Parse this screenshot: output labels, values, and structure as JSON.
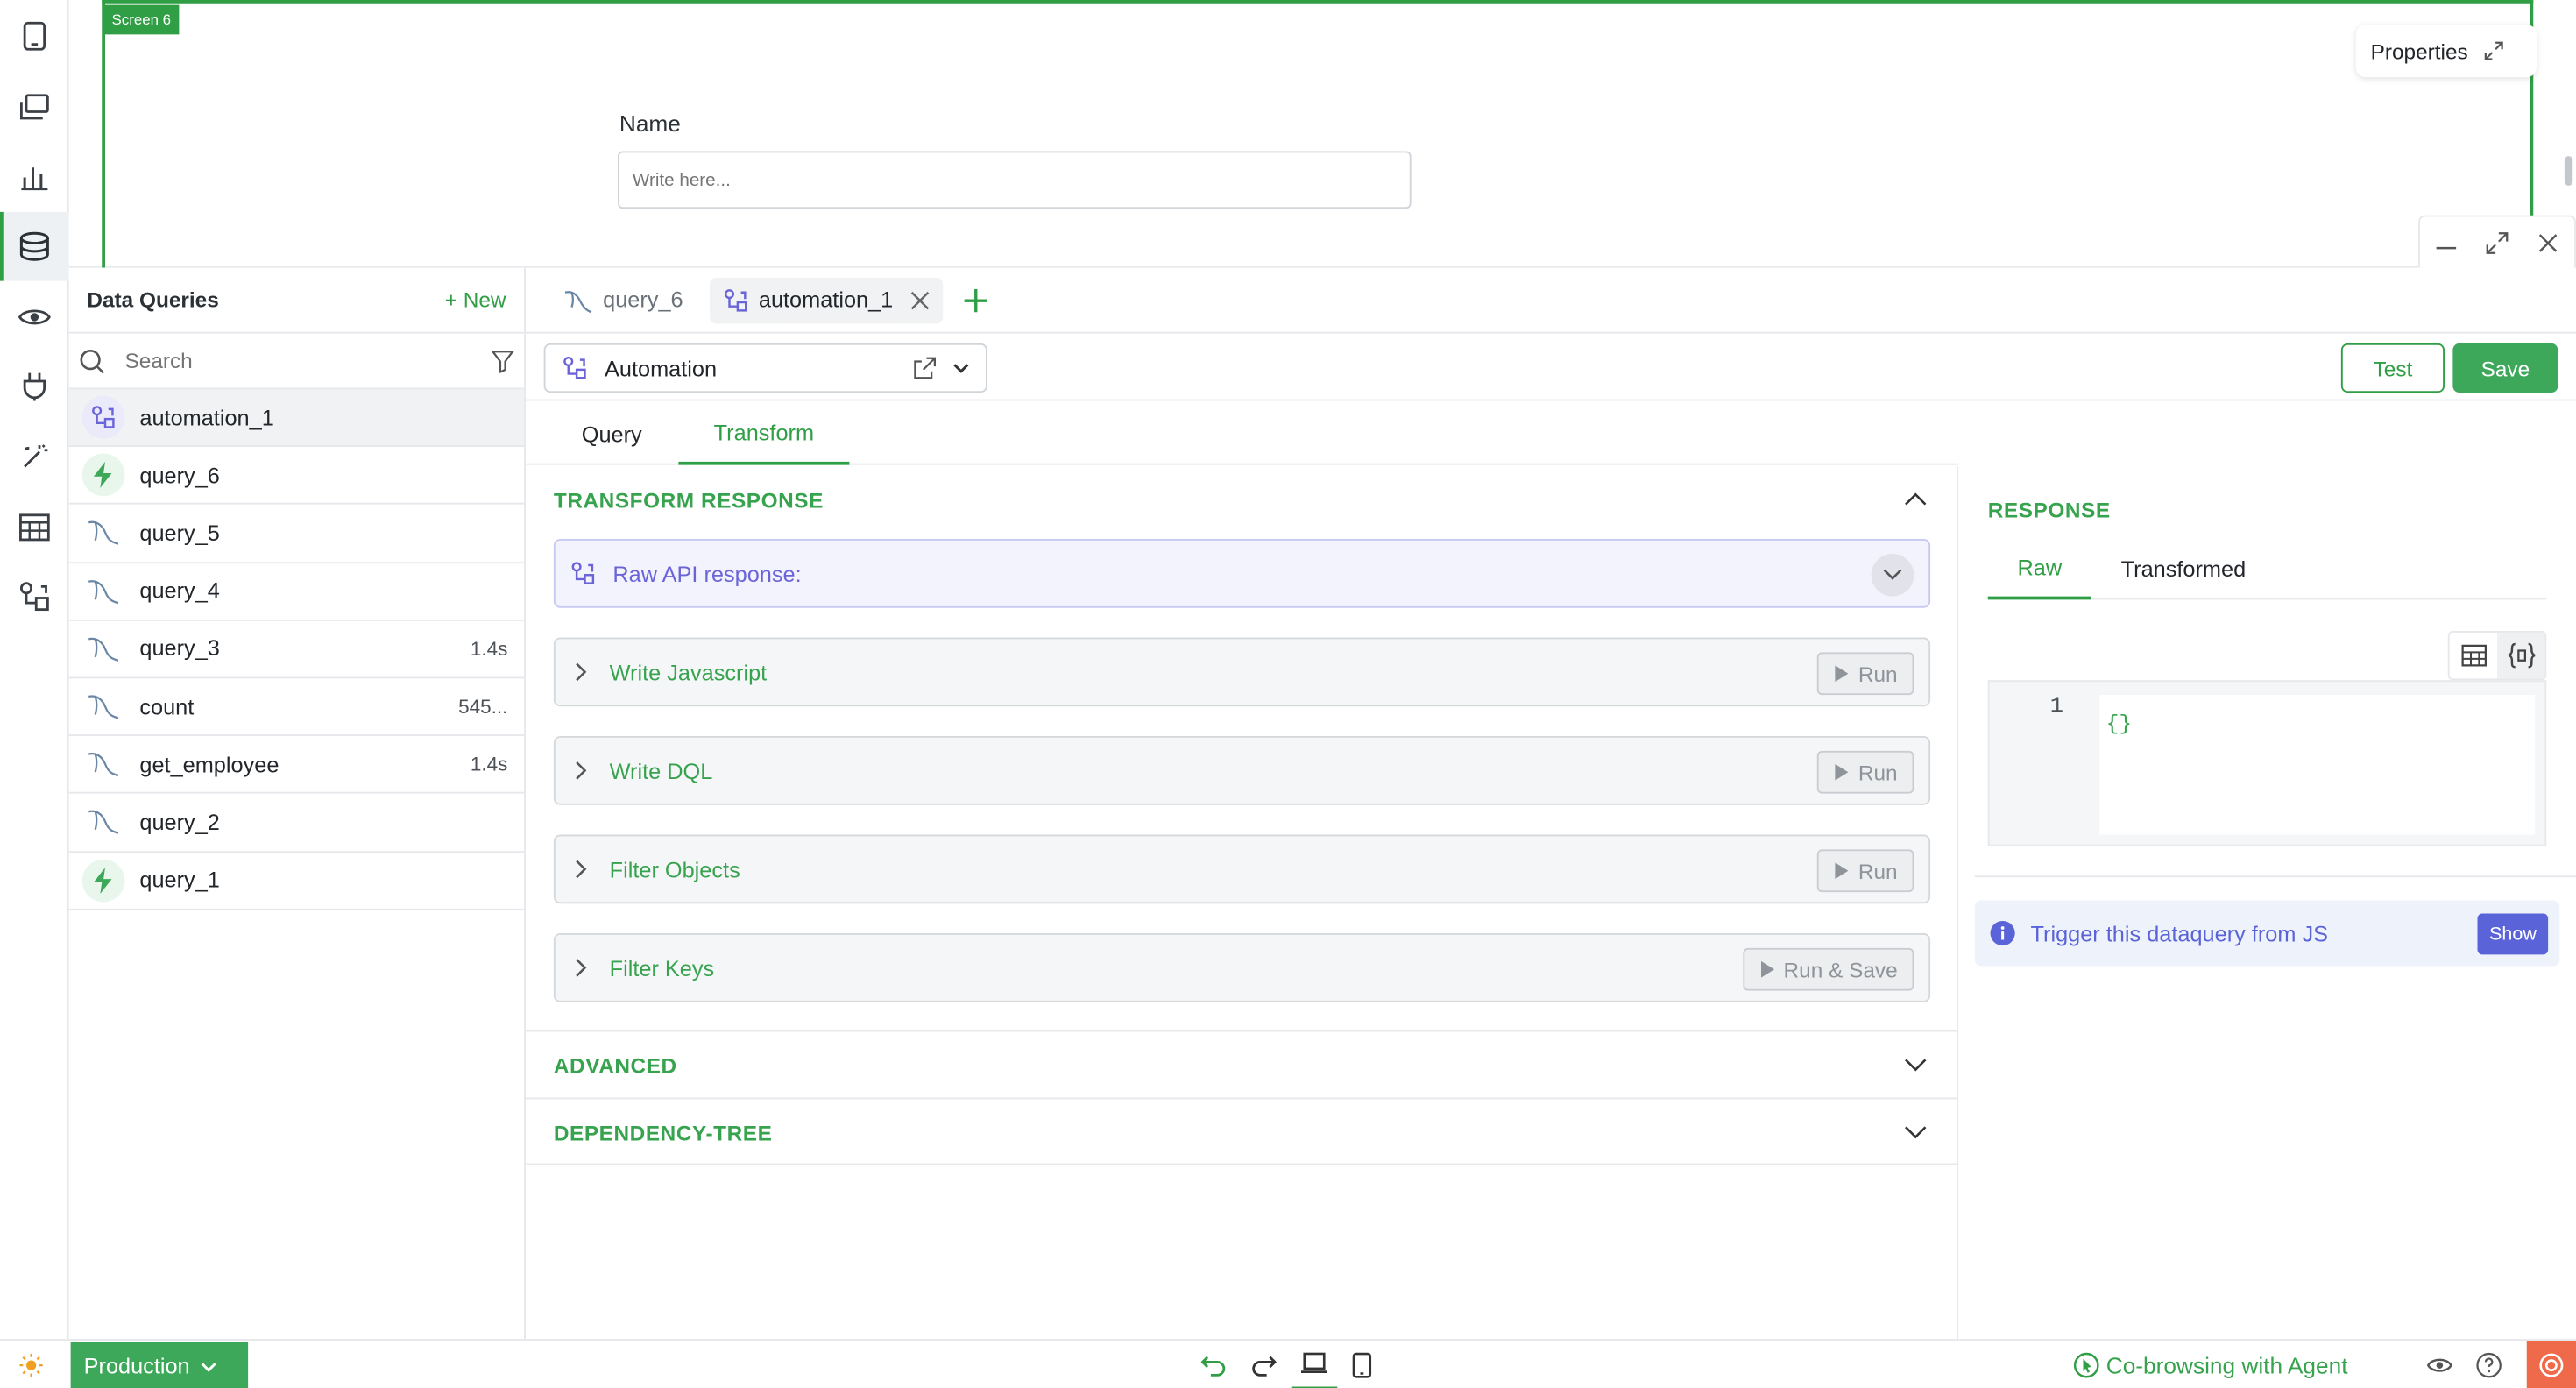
{
  "canvas": {
    "screen_tag": "Screen 6",
    "field_label": "Name",
    "field_placeholder": "Write here...",
    "properties_label": "Properties"
  },
  "queries_panel": {
    "title": "Data Queries",
    "new_label": "+ New",
    "search_placeholder": "Search",
    "items": [
      {
        "name": "automation_1",
        "meta": "",
        "icon": "automation-icon"
      },
      {
        "name": "query_6",
        "meta": "",
        "icon": "bolt-icon"
      },
      {
        "name": "query_5",
        "meta": "",
        "icon": "mysql-icon"
      },
      {
        "name": "query_4",
        "meta": "",
        "icon": "mysql-icon"
      },
      {
        "name": "query_3",
        "meta": "1.4s",
        "icon": "mysql-icon"
      },
      {
        "name": "count",
        "meta": "545...",
        "icon": "mysql-icon"
      },
      {
        "name": "get_employee",
        "meta": "1.4s",
        "icon": "mysql-icon"
      },
      {
        "name": "query_2",
        "meta": "",
        "icon": "mysql-icon"
      },
      {
        "name": "query_1",
        "meta": "",
        "icon": "bolt-icon"
      }
    ]
  },
  "tabs": [
    {
      "label": "query_6",
      "icon": "mysql-icon"
    },
    {
      "label": "automation_1",
      "icon": "automation-icon"
    }
  ],
  "toolbar": {
    "datasource": "Automation",
    "test_label": "Test",
    "save_label": "Save"
  },
  "subtabs": {
    "query": "Query",
    "transform": "Transform"
  },
  "transform": {
    "title": "TRANSFORM RESPONSE",
    "raw_label": "Raw API response:",
    "steps": [
      {
        "label": "Write Javascript",
        "action": "Run"
      },
      {
        "label": "Write DQL",
        "action": "Run"
      },
      {
        "label": "Filter Objects",
        "action": "Run"
      },
      {
        "label": "Filter Keys",
        "action": "Run & Save"
      }
    ],
    "advanced": "ADVANCED",
    "dependency": "DEPENDENCY-TREE"
  },
  "response": {
    "title": "RESPONSE",
    "tab_raw": "Raw",
    "tab_transformed": "Transformed",
    "line_number": "1",
    "code": "{}",
    "trigger_text": "Trigger this dataquery from JS",
    "show_label": "Show"
  },
  "bottombar": {
    "environment": "Production",
    "cobrowse_label": "Co-browsing with Agent"
  },
  "colors": {
    "accent": "#2f9e44",
    "automation": "#6b64d9",
    "info": "#5a63d8"
  }
}
